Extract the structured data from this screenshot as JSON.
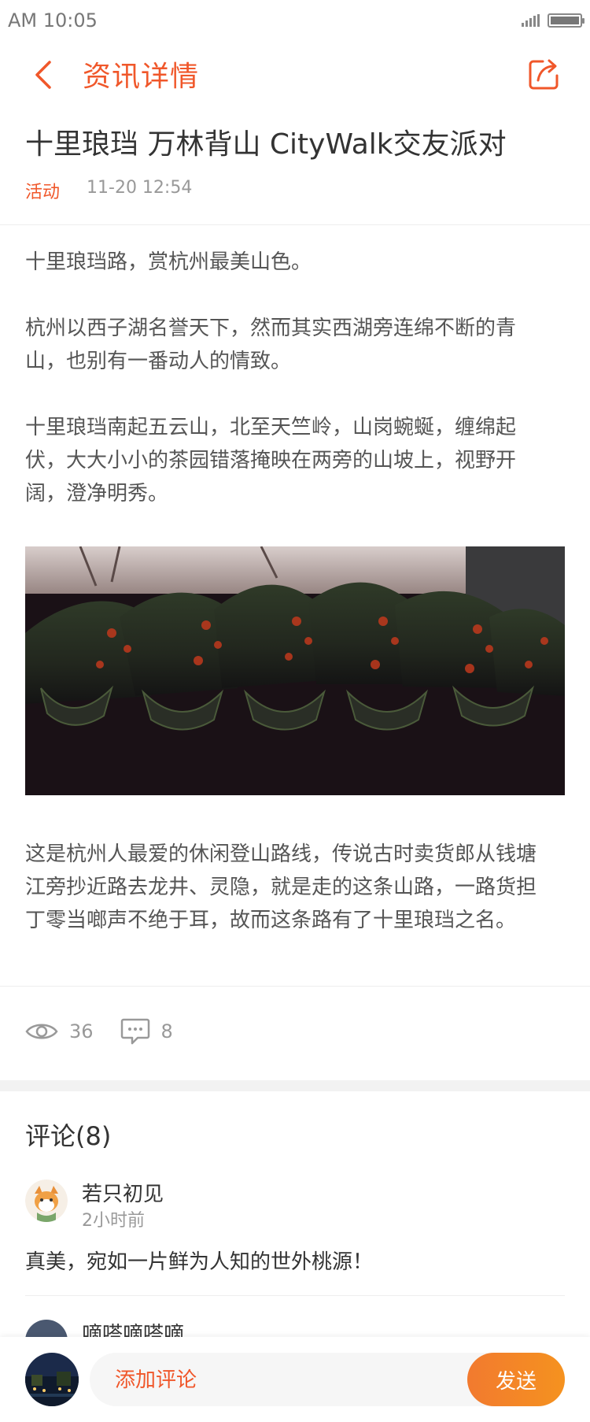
{
  "status": {
    "time": "AM 10:05"
  },
  "nav": {
    "title": "资讯详情"
  },
  "article": {
    "title": "十里琅珰 万林背山 CityWalk交友派对",
    "category": "活动",
    "datetime": "11-20 12:54",
    "paragraphs": [
      "十里琅珰路，赏杭州最美山色。",
      "杭州以西子湖名誉天下，然而其实西湖旁连绵不断的青山，也别有一番动人的情致。",
      "十里琅珰南起五云山，北至天竺岭，山岗蜿蜒，缠绵起伏，大大小小的茶园错落掩映在两旁的山坡上，视野开阔，澄净明秀。"
    ],
    "paragraph_after_image": "这是杭州人最爱的休闲登山路线，传说古时卖货郎从钱塘江旁抄近路去龙井、灵隐，就是走的这条山路，一路货担丁零当啷声不绝于耳，故而这条路有了十里琅珰之名。"
  },
  "stats": {
    "views": "36",
    "comments": "8"
  },
  "comments_section": {
    "title": "评论(8)",
    "items": [
      {
        "name": "若只初见",
        "time": "2小时前",
        "text": "真美，宛如一片鲜为人知的世外桃源！"
      },
      {
        "name": "嘀嗒嘀嗒嘀"
      }
    ]
  },
  "bottom": {
    "placeholder": "添加评论",
    "send_label": "发送"
  },
  "colors": {
    "accent": "#f0572a",
    "send_gradient_start": "#f27a2f",
    "send_gradient_end": "#f5921f"
  }
}
